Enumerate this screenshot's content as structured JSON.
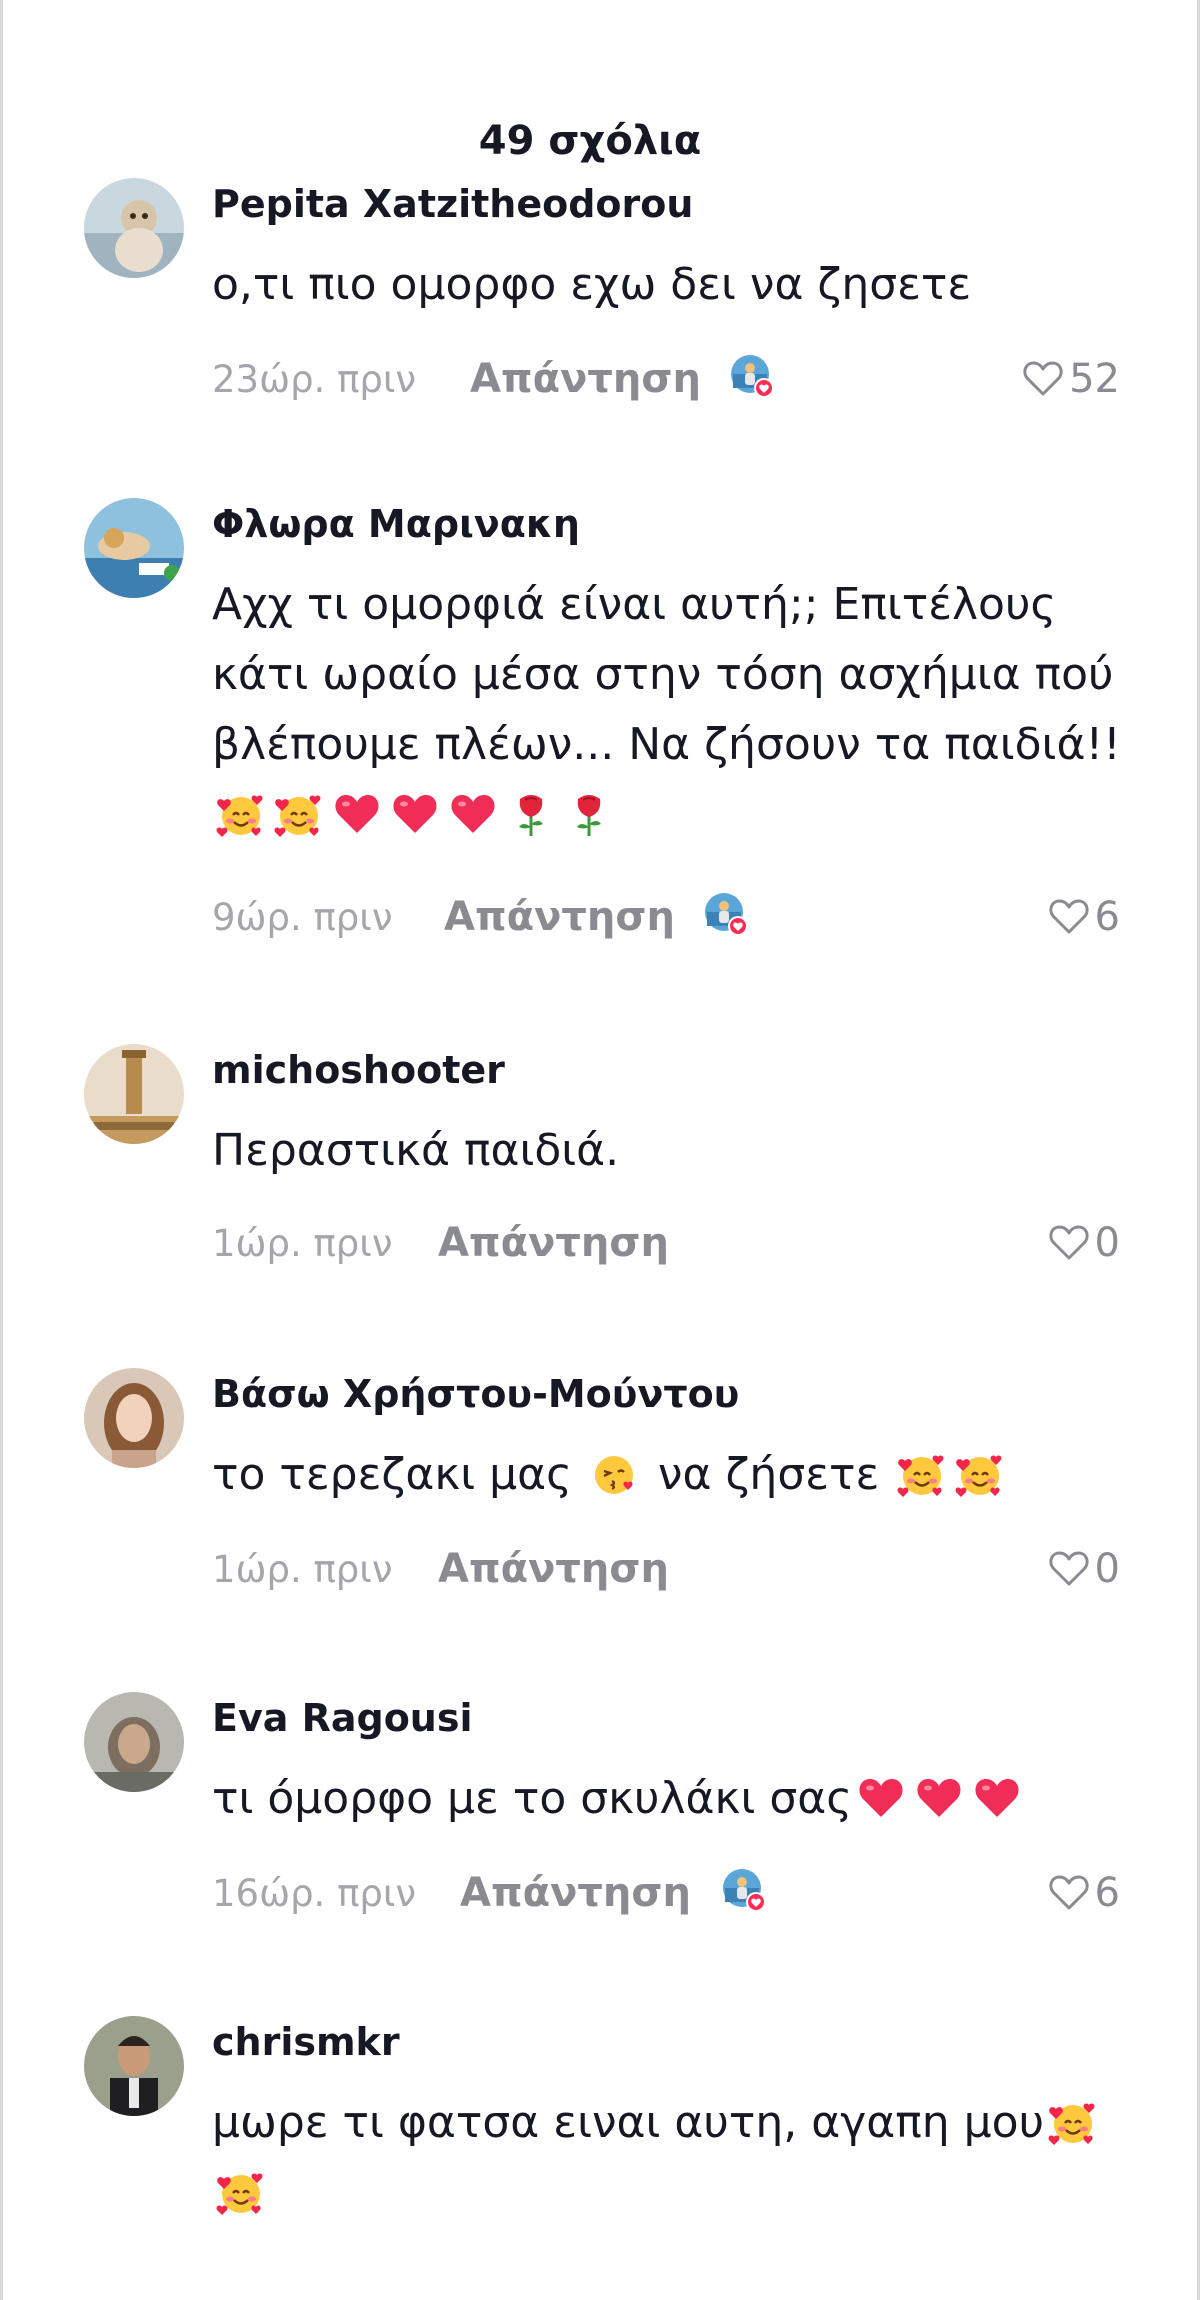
{
  "header": {
    "title": "49 σχόλια"
  },
  "reply_label": "Απάντηση",
  "comments": [
    {
      "username": "Pepita Xatzitheodorou",
      "lines": [
        "ο,τι πιο ομορφο εχω δει να ζησετε"
      ],
      "time": "23ώρ. πριν",
      "likes": "52",
      "author_liked": true
    },
    {
      "username": "Φλωρα Μαρινακη",
      "lines": [
        "Αχχ τι ομορφιά είναι αυτή;; Επιτέλους",
        "κάτι ωραίο μέσα στην τόση ασχήμια πού",
        "βλέπουμε πλέων... Να ζήσουν τα παιδιά!!"
      ],
      "time": "9ώρ. πριν",
      "likes": "6",
      "author_liked": true
    },
    {
      "username": "michoshooter",
      "lines": [
        "Περαστικά παιδιά."
      ],
      "time": "1ώρ. πριν",
      "likes": "0",
      "author_liked": false
    },
    {
      "username": "Βάσω Χρήστου-Μούντου",
      "lines": [
        "το τερεζακι μας ",
        " να ζήσετε "
      ],
      "time": "1ώρ. πριν",
      "likes": "0",
      "author_liked": false
    },
    {
      "username": "Eva Ragousi",
      "lines": [
        "τι όμορφο με το σκυλάκι σας"
      ],
      "time": "16ώρ. πριν",
      "likes": "6",
      "author_liked": true
    },
    {
      "username": "chrismkr",
      "lines": [
        "μωρε τι φατσα ειναι αυτη, αγαπη μου"
      ],
      "time": "",
      "likes": "",
      "author_liked": false
    }
  ],
  "icons": {
    "like": "heart-outline-icon",
    "author_liked": "creator-liked-badge-icon",
    "emoji_hearts_face": "smiling-face-with-hearts-icon",
    "emoji_heart": "red-heart-icon",
    "emoji_rose": "rose-icon",
    "emoji_kiss": "face-blowing-kiss-icon"
  },
  "colors": {
    "text": "#161823",
    "muted": "#a5a6ab",
    "reply": "#8a8b91",
    "heart": "#fe2c55"
  }
}
